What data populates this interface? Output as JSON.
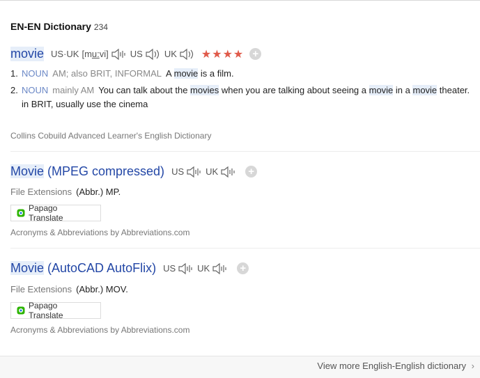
{
  "section": {
    "title": "EN-EN Dictionary",
    "count": "234"
  },
  "entry1": {
    "headword": "movie",
    "pron_us_uk_tag": "US·UK",
    "ipa_pre": "[m",
    "ipa_under": "u:",
    "ipa_post": "vi]",
    "us_label": "US",
    "uk_label": "UK",
    "stars": "★★★★",
    "senses": [
      {
        "num": "1.",
        "pos": "NOUN",
        "gram": "AM; also BRIT, INFORMAL",
        "text_a": "A ",
        "hl_a": "movie",
        "text_b": " is a film."
      },
      {
        "num": "2.",
        "pos": "NOUN",
        "gram": "mainly AM",
        "text_a": "You can talk about the ",
        "hl_a": "movies",
        "text_b": " when you are talking about seeing a ",
        "hl_b": "movie",
        "text_c": " in a ",
        "hl_c": "movie",
        "text_d": " theater.",
        "sub": "in BRIT, usually use the cinema"
      }
    ],
    "source": "Collins Cobuild Advanced Learner's English Dictionary"
  },
  "entry2": {
    "headword_hl": "Movie",
    "headword_rest": " (MPEG compressed)",
    "us_label": "US",
    "uk_label": "UK",
    "file_label": "File Extensions",
    "file_value": "(Abbr.) MP.",
    "papago": "Papago Translate",
    "source": "Acronyms & Abbreviations by Abbreviations.com"
  },
  "entry3": {
    "headword_hl": "Movie",
    "headword_rest": " (AutoCAD AutoFlix)",
    "us_label": "US",
    "uk_label": "UK",
    "file_label": "File Extensions",
    "file_value": "(Abbr.) MOV.",
    "papago": "Papago Translate",
    "source": "Acronyms & Abbreviations by Abbreviations.com"
  },
  "footer": {
    "view_more": "View more English-English dictionary"
  },
  "icons": {
    "speaker": "speaker-icon",
    "plus": "plus-icon",
    "papago": "papago-logo-icon",
    "chevron": "chevron-right-icon"
  },
  "colors": {
    "headword": "#2347a6",
    "pos": "#6b88c6",
    "stars": "#e05a4a",
    "highlight": "#e6eef9"
  }
}
